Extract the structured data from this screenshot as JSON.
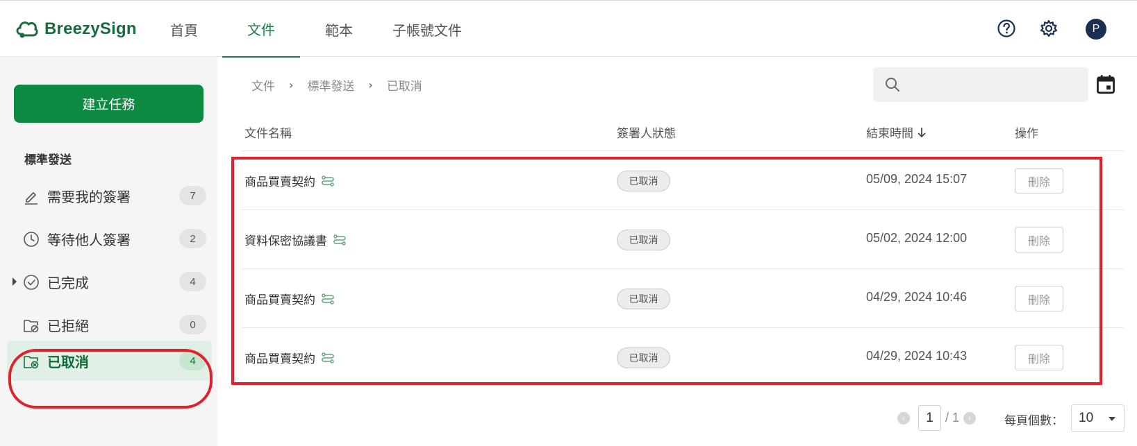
{
  "brand": {
    "name": "BreezySign",
    "color": "#1b6b3f"
  },
  "nav": {
    "items": [
      {
        "label": "首頁"
      },
      {
        "label": "文件",
        "active": true
      },
      {
        "label": "範本"
      },
      {
        "label": "子帳號文件"
      }
    ],
    "icons": [
      "help-icon",
      "settings-icon"
    ],
    "avatar_initial": "P"
  },
  "sidebar": {
    "create_button": "建立任務",
    "section_title": "標準發送",
    "items": [
      {
        "label": "需要我的簽署",
        "count": "7",
        "icon": "pen-icon"
      },
      {
        "label": "等待他人簽署",
        "count": "2",
        "icon": "clock-icon"
      },
      {
        "label": "已完成",
        "count": "4",
        "icon": "check-circle-icon"
      },
      {
        "label": "已拒絕",
        "count": "0",
        "icon": "folder-block-icon"
      },
      {
        "label": "已取消",
        "count": "4",
        "icon": "folder-cancel-icon",
        "active": true
      }
    ]
  },
  "breadcrumb": [
    "文件",
    "標準發送",
    "已取消"
  ],
  "search": {
    "placeholder": "",
    "value": ""
  },
  "table": {
    "headers": {
      "name": "文件名稱",
      "status": "簽署人狀態",
      "end_time": "結束時間",
      "action": "操作"
    },
    "rows": [
      {
        "name": "商品買賣契約",
        "status": "已取消",
        "end_time": "05/09, 2024 15:07",
        "action": "刪除"
      },
      {
        "name": "資料保密協議書",
        "status": "已取消",
        "end_time": "05/02, 2024 12:00",
        "action": "刪除"
      },
      {
        "name": "商品買賣契約",
        "status": "已取消",
        "end_time": "04/29, 2024 10:46",
        "action": "刪除"
      },
      {
        "name": "商品買賣契約",
        "status": "已取消",
        "end_time": "04/29, 2024 10:43",
        "action": "刪除"
      }
    ]
  },
  "pagination": {
    "current_page": "1",
    "total": "/ 1",
    "per_page_label": "每頁個數：",
    "per_page_value": "10"
  },
  "colors": {
    "primary_green": "#0e8a43",
    "annotation_red": "#e0202a"
  }
}
